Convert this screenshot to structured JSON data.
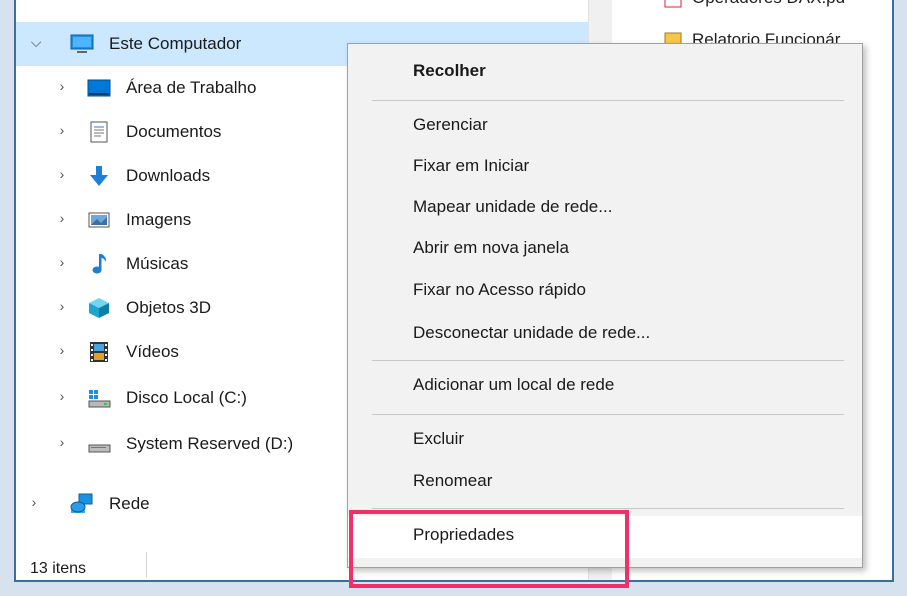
{
  "nav": {
    "items": [
      {
        "label": "Este Computador",
        "icon": "computer-icon"
      },
      {
        "label": "Área de Trabalho",
        "icon": "desktop-icon"
      },
      {
        "label": "Documentos",
        "icon": "documents-icon"
      },
      {
        "label": "Downloads",
        "icon": "download-arrow-icon"
      },
      {
        "label": "Imagens",
        "icon": "pictures-icon"
      },
      {
        "label": "Músicas",
        "icon": "music-note-icon"
      },
      {
        "label": "Objetos 3D",
        "icon": "cube-3d-icon"
      },
      {
        "label": "Vídeos",
        "icon": "film-icon"
      },
      {
        "label": "Disco Local (C:)",
        "icon": "windows-drive-icon"
      },
      {
        "label": "System Reserved (D:)",
        "icon": "drive-icon"
      },
      {
        "label": "Rede",
        "icon": "network-icon"
      }
    ]
  },
  "files": {
    "items": [
      "Operadores DAX.pd",
      "Relatorio Funcionár"
    ]
  },
  "status": {
    "count": "13 itens"
  },
  "context_menu": {
    "items": {
      "recolher": "Recolher",
      "gerenciar": "Gerenciar",
      "fixar_iniciar": "Fixar em Iniciar",
      "mapear": "Mapear unidade de rede...",
      "abrir_nova": "Abrir em nova janela",
      "fixar_acesso": "Fixar no Acesso rápido",
      "desconectar": "Desconectar unidade de rede...",
      "adicionar_local": "Adicionar um local de rede",
      "excluir": "Excluir",
      "renomear": "Renomear",
      "propriedades": "Propriedades"
    }
  },
  "colors": {
    "selection": "#cce8ff",
    "highlight": "#f0306a",
    "frame": "#3b6f99"
  }
}
